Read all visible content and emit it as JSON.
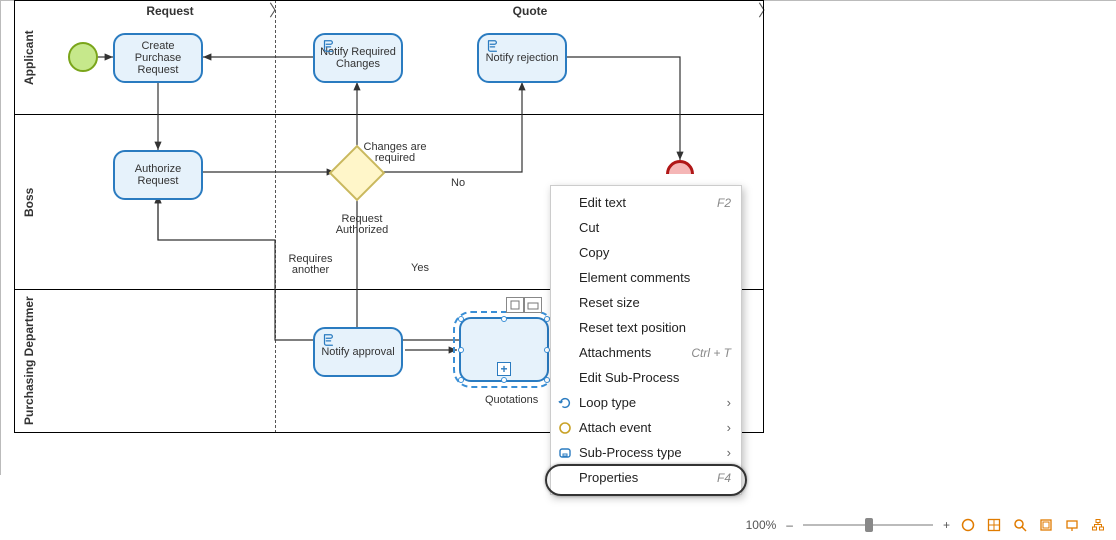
{
  "phases": {
    "request": "Request",
    "quote": "Quote"
  },
  "lanes": {
    "applicant": "Applicant",
    "boss": "Boss",
    "purchasing": "Purchasing Departmer"
  },
  "tasks": {
    "create_pr": "Create Purchase Request",
    "notify_changes": "Notify Required Changes",
    "notify_rejection": "Notify rejection",
    "authorize": "Authorize Request",
    "notify_approval": "Notify approval",
    "subproc_label": "Quotations"
  },
  "labels": {
    "changes_required": "Changes are required",
    "request_authorized": "Request Authorized",
    "requires_another": "Requires another",
    "no": "No",
    "yes": "Yes"
  },
  "context_menu": {
    "edit_text": "Edit text",
    "edit_text_key": "F2",
    "cut": "Cut",
    "copy": "Copy",
    "element_comments": "Element comments",
    "reset_size": "Reset size",
    "reset_text_pos": "Reset text position",
    "attachments": "Attachments",
    "attachments_key": "Ctrl + T",
    "edit_subprocess": "Edit Sub-Process",
    "loop_type": "Loop type",
    "attach_event": "Attach event",
    "subprocess_type": "Sub-Process type",
    "properties": "Properties",
    "properties_key": "F4"
  },
  "status": {
    "zoom": "100%",
    "minus": "–",
    "plus": "+"
  },
  "chart_data": {
    "type": "bpmn-diagram",
    "phases": [
      "Request",
      "Quote"
    ],
    "lanes": [
      "Applicant",
      "Boss",
      "Purchasing Department"
    ],
    "nodes": [
      {
        "id": "start",
        "type": "start-event",
        "lane": "Applicant"
      },
      {
        "id": "create_pr",
        "type": "task",
        "lane": "Applicant",
        "label": "Create Purchase Request"
      },
      {
        "id": "notify_changes",
        "type": "script-task",
        "lane": "Applicant",
        "label": "Notify Required Changes"
      },
      {
        "id": "notify_rejection",
        "type": "script-task",
        "lane": "Applicant",
        "label": "Notify rejection"
      },
      {
        "id": "authorize",
        "type": "task",
        "lane": "Boss",
        "label": "Authorize Request"
      },
      {
        "id": "gateway",
        "type": "exclusive-gateway",
        "lane": "Boss"
      },
      {
        "id": "end_reject",
        "type": "end-event",
        "lane": "Boss"
      },
      {
        "id": "notify_approval",
        "type": "script-task",
        "lane": "Purchasing Department",
        "label": "Notify approval"
      },
      {
        "id": "quotations",
        "type": "collapsed-subprocess",
        "lane": "Purchasing Department",
        "label": "Quotations",
        "selected": true
      }
    ],
    "flows": [
      {
        "from": "start",
        "to": "create_pr"
      },
      {
        "from": "create_pr",
        "to": "authorize"
      },
      {
        "from": "authorize",
        "to": "gateway"
      },
      {
        "from": "gateway",
        "to": "notify_changes",
        "label": "Changes are required"
      },
      {
        "from": "notify_changes",
        "to": "create_pr"
      },
      {
        "from": "gateway",
        "to": "notify_rejection",
        "label": "No",
        "then": "end_reject"
      },
      {
        "from": "gateway",
        "to": "notify_approval",
        "label": "Request Authorized / Yes"
      },
      {
        "from": "notify_approval",
        "to": "quotations"
      },
      {
        "from": "quotations",
        "to": "authorize",
        "label": "Requires another"
      }
    ]
  }
}
